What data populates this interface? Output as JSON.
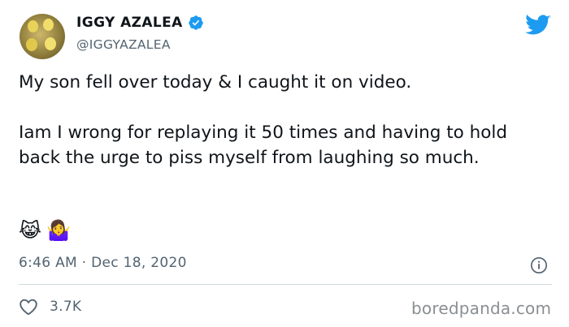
{
  "author": {
    "name": "IGGY AZALEA",
    "handle": "@IGGYAZALEA",
    "verified_icon": "verified-badge-icon",
    "avatar": "avatar"
  },
  "platform_icon": "twitter-bird-icon",
  "tweet": {
    "line1": "My son fell over today & I caught it on video.",
    "line2": "Iam I wrong for replaying it 50 times and having to hold back the urge to piss myself from laughing so much.",
    "emoji1": "😹",
    "emoji2": "🤷‍♀️"
  },
  "meta": {
    "timestamp": "6:46 AM · Dec 18, 2020",
    "info_icon": "info-icon"
  },
  "engagement": {
    "like_icon": "heart-icon",
    "like_count": "3.7K"
  },
  "watermark": "boredpanda.com",
  "colors": {
    "accent": "#1d9bf0",
    "text": "#0f1419",
    "secondary_text": "#536471",
    "divider": "#cfd9de"
  }
}
